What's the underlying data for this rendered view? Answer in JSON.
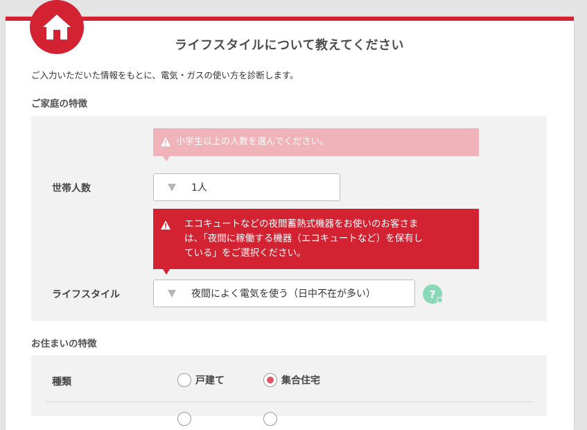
{
  "page": {
    "title": "ライフスタイルについて教えてください",
    "intro": "ご入力いただいた情報をもとに、電気・ガスの使い方を診断します。"
  },
  "household": {
    "heading": "ご家庭の特徴",
    "alert_children": "小学生以上の人数を選んでください。",
    "size_label": "世帯人数",
    "size_value": "1人",
    "alert_lifestyle_lines": [
      "エコキュートなどの夜間蓄熱式機器をお使いのお客さま",
      "は、「夜間に稼働する機器（エコキュートなど）を保有し",
      "ている」をご選択ください。"
    ],
    "lifestyle_label": "ライフスタイル",
    "lifestyle_value": "夜間によく電気を使う（日中不在が多い）",
    "help_label": "?"
  },
  "residence": {
    "heading": "お住まいの特徴",
    "type_label": "種類",
    "options": [
      "戸建て",
      "集合住宅"
    ],
    "selected": "集合住宅"
  },
  "colors": {
    "brand_red": "#d32232",
    "alert_soft": "#f0b3b9",
    "help_green": "#89d9b9",
    "radio_dot": "#e05566"
  },
  "icons": {
    "home": "home-icon",
    "warning": "warning-icon",
    "dropdown": "dropdown-arrow-icon"
  }
}
